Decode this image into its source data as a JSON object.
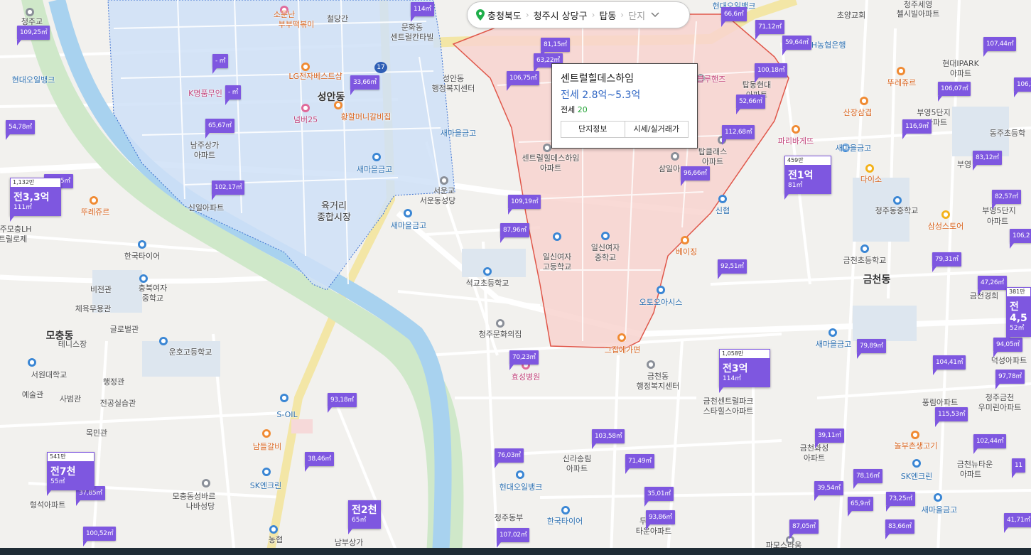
{
  "breadcrumb": {
    "province": "충청북도",
    "city": "청주시 상당구",
    "dong": "탑동",
    "complex": "단지"
  },
  "popup": {
    "name": "센트럴힐데스하임",
    "price": "전세 2.8억~5.3억",
    "count_label": "전세",
    "count_value": "20",
    "btn_info": "단지정보",
    "btn_price": "시세/실거래가"
  },
  "labels": {
    "a1": "청주교",
    "a2": "소문난",
    "a3": "부부떡볶이",
    "a4": "철당간",
    "a5": "문화동",
    "a6": "센트럴칸타빌",
    "a7": "LG전자베스트샵",
    "a8": "성안동",
    "a9": "성안동",
    "a10": "행정복지센터",
    "a11": "현대오일뱅크",
    "a12": "K명품무인",
    "a13": "넘버25",
    "a14": "황할머니갈비집",
    "a15": "새마을금고",
    "a16": "남주상가",
    "a17": "아파트",
    "a18": "새마을금고",
    "a19": "서운교",
    "a20": "서운동성당",
    "a21": "육거리",
    "a22": "종합시장",
    "a23": "신일아파트",
    "a24": "새마을금고",
    "a25": "뚜레쥬르",
    "a26": "주모충LH",
    "a27": "트릴로제",
    "a28": "한국타이어",
    "a29": "비전관",
    "a30": "충북여자",
    "a31": "중학교",
    "a32": "체육무용관",
    "a33": "글로벌관",
    "a34": "모충동",
    "a35": "테니스장",
    "a36": "운호고등학교",
    "a37": "서원대학교",
    "a38": "행정관",
    "a39": "예술관",
    "a40": "사범관",
    "a41": "전공실습관",
    "a42": "목민관",
    "a43": "S-OIL",
    "a44": "남들갈비",
    "a45": "SK엔크린",
    "a46": "모충동성바르",
    "a47": "나바성당",
    "a48": "형석아파트",
    "a49": "농협",
    "a50": "남부상가",
    "a51": "석교초등학교",
    "a52": "청주문화의집",
    "a53": "효성병원",
    "a54": "센트럴힐데스하임",
    "a55": "아파트",
    "a56": "일신여자",
    "a57": "고등학교",
    "a58": "일신여자",
    "a59": "중학교",
    "a60": "삼일아",
    "a61": "탑클래스",
    "a62": "아파트",
    "a63": "블루핸즈",
    "a64": "탑동현대",
    "a65": "아파트",
    "a66": "신협",
    "a67": "베이징",
    "a68": "오토오아시스",
    "a69": "그집에가면",
    "a70": "금천동",
    "a71": "행정복지센터",
    "a72": "금천센트럴파크",
    "a73": "스타힐스아파트",
    "a74": "신라송림",
    "a75": "아파트",
    "a76": "현대오일뱅크",
    "a77": "청주동부",
    "a78": "한국타이어",
    "a79": "두산",
    "a80": "타운아파트",
    "a81": "파모스라움",
    "a82": "금천화성",
    "a83": "아파트",
    "a84": "현대오일뱅크",
    "a85": "NH농협은행",
    "a86": "초양교회",
    "a87": "청주세영",
    "a88": "첼시빌아파트",
    "a89": "뚜레쥬르",
    "a90": "산장삼겹",
    "a91": "파리바게뜨",
    "a92": "새마을금고",
    "a93": "다이소",
    "a94": "청주동중학교",
    "a95": "금천초등학교",
    "a96": "금천동",
    "a97": "새마을금고",
    "a98": "부영5단지",
    "a99": "아파트",
    "a100": "현대IPARK",
    "a101": "아파트",
    "a102": "동주초등학",
    "a103": "부영",
    "a104": "삼성스토어",
    "a105": "부영5단지",
    "a106": "아파트",
    "a107": "금천경희",
    "a108": "풍림아파트",
    "a109": "덕성아파트",
    "a110": "청주금천",
    "a111": "우미린아파트",
    "a112": "놀부촌생고기",
    "a113": "SK엔크린",
    "a114": "금천뉴타운",
    "a115": "아파트",
    "a116": "새마을금고",
    "a117": "한",
    "a118": "성안동",
    "a119": "파리바게뜨"
  },
  "markers": {
    "m1": "109,25㎡",
    "m2": "54,78㎡",
    "m3": "80,55㎡",
    "m4": "- ㎡",
    "m5": "- ㎡",
    "m6": "33,66㎡",
    "m7": "65,67㎡",
    "m8": "102,17㎡",
    "m9": "81,15㎡",
    "m10": "63,22㎡",
    "m11": "106,75㎡",
    "m12": "66,6㎡",
    "m13": "71,12㎡",
    "m14": "59,64㎡",
    "m15": "100,18㎡",
    "m16": "52,66㎡",
    "m17": "112,68㎡",
    "m18": "96,66㎡",
    "m19": "109,19㎡",
    "m20": "87,96㎡",
    "m21": "92,51㎡",
    "m22": "70,23㎡",
    "m23": "93,18㎡",
    "m24": "38,46㎡",
    "m25": "76,03㎡",
    "m26": "103,58㎡",
    "m27": "71,49㎡",
    "m28": "35,01㎡",
    "m29": "93,86㎡",
    "m30": "107,02㎡",
    "m31": "87,05㎡",
    "m32": "39,11㎡",
    "m33": "39,54㎡",
    "m34": "78,16㎡",
    "m35": "65,9㎡",
    "m36": "73,25㎡",
    "m37": "83,66㎡",
    "m38": "102,44㎡",
    "m39": "115,53㎡",
    "m40": "104,41㎡",
    "m41": "79,89㎡",
    "m42": "97,78㎡",
    "m43": "94,05㎡",
    "m44": "47,26㎡",
    "m45": "79,31㎡",
    "m46": "106,07㎡",
    "m47": "116,9㎡",
    "m48": "107,44㎡",
    "m49": "83,12㎡",
    "m50": "82,57㎡",
    "m51": "37,85㎡",
    "m52": "100,52㎡",
    "m53": "41,71㎡",
    "m54": "114㎡",
    "m55": "106,2",
    "m56": "106,3",
    "m57": "11"
  },
  "big_markers": {
    "b1": {
      "top": "1,132만",
      "price": "전3,3억",
      "area": "111㎡"
    },
    "b2": {
      "top": "459만",
      "price": "전1억",
      "area": "81㎡"
    },
    "b3": {
      "top": "1,058만",
      "price": "전3억",
      "area": "114㎡"
    },
    "b4": {
      "top": "541만",
      "price": "전7천",
      "area": "55㎡"
    },
    "b5": {
      "top": "381만",
      "price": "전4,5",
      "area": "52㎡"
    },
    "b6": {
      "top": "",
      "price": "전2천",
      "area": "65㎡"
    }
  },
  "road_shield": "17",
  "colors": {
    "marker": "#7e57e0",
    "region_blue": "#cfe0f7",
    "region_pink": "#f8d3cf",
    "river": "#a8d2ef",
    "park": "#cfe8c9",
    "road_major": "#f3e6a6"
  }
}
